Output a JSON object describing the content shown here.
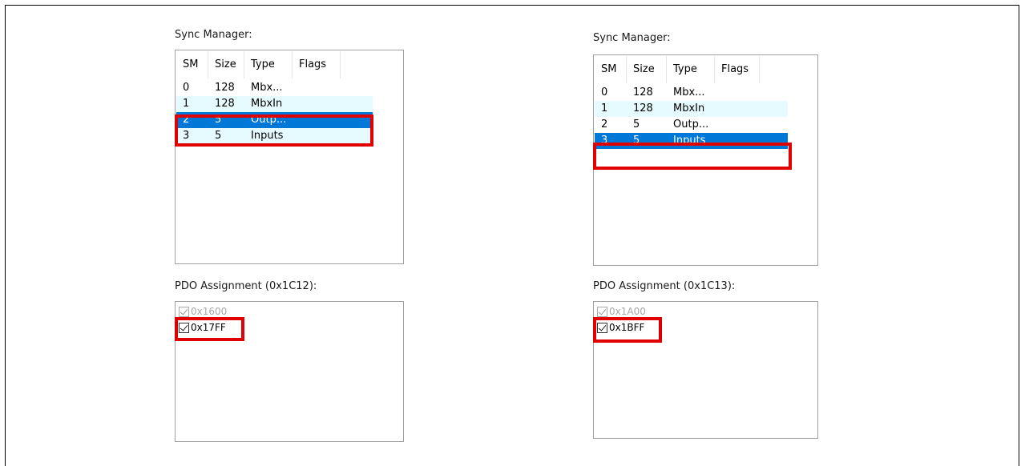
{
  "left": {
    "sync_label": "Sync Manager:",
    "columns": [
      "SM",
      "Size",
      "Type",
      "Flags"
    ],
    "rows": [
      {
        "sm": "0",
        "size": "128",
        "type": "Mbx..."
      },
      {
        "sm": "1",
        "size": "128",
        "type": "MbxIn"
      },
      {
        "sm": "2",
        "size": "5",
        "type": "Outp..."
      },
      {
        "sm": "3",
        "size": "5",
        "type": "Inputs"
      }
    ],
    "selected_row": 2,
    "pdo_label": "PDO Assignment (0x1C12):",
    "pdo_items": [
      {
        "label": "0x1600",
        "checked": true,
        "enabled": false
      },
      {
        "label": "0x17FF",
        "checked": true,
        "enabled": true
      }
    ]
  },
  "right": {
    "sync_label": "Sync Manager:",
    "columns": [
      "SM",
      "Size",
      "Type",
      "Flags"
    ],
    "rows": [
      {
        "sm": "0",
        "size": "128",
        "type": "Mbx..."
      },
      {
        "sm": "1",
        "size": "128",
        "type": "MbxIn"
      },
      {
        "sm": "2",
        "size": "5",
        "type": "Outp..."
      },
      {
        "sm": "3",
        "size": "5",
        "type": "Inputs"
      }
    ],
    "selected_row": 3,
    "pdo_label": "PDO Assignment (0x1C13):",
    "pdo_items": [
      {
        "label": "0x1A00",
        "checked": true,
        "enabled": false
      },
      {
        "label": "0x1BFF",
        "checked": true,
        "enabled": true
      }
    ]
  },
  "colors": {
    "selection": "#0078d7",
    "alt_row": "#e6fbff",
    "highlight_box": "#e00000"
  }
}
